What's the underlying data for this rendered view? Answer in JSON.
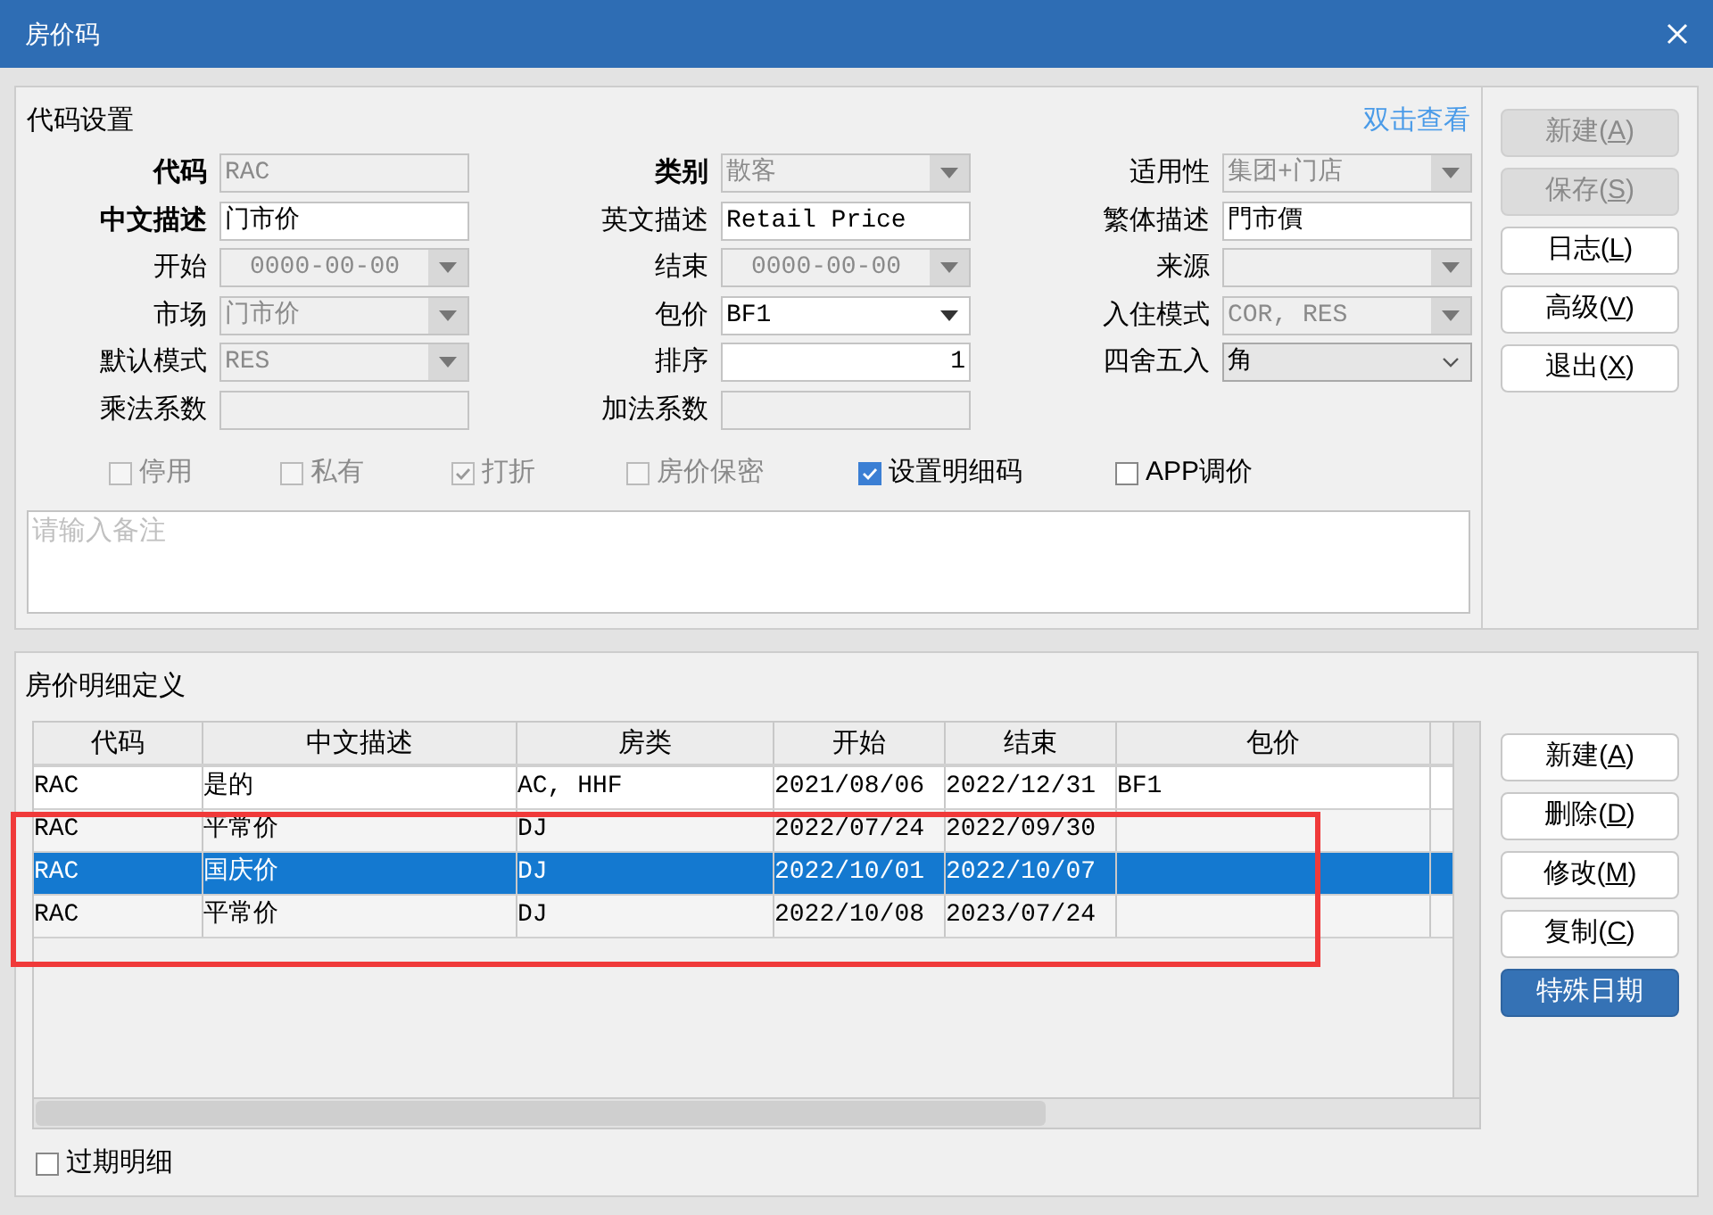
{
  "window": {
    "title": "房价码"
  },
  "code_settings": {
    "title": "代码设置",
    "link": "双击查看",
    "form_rows": [
      {
        "fields": [
          {
            "label": "代码",
            "bold": true,
            "kind": "text",
            "disabled": true,
            "value": "RAC"
          },
          {
            "label": "类别",
            "bold": true,
            "kind": "select",
            "disabled": true,
            "value": "散客"
          },
          {
            "label": "适用性",
            "bold": false,
            "kind": "select",
            "disabled": true,
            "value": "集团+门店"
          }
        ]
      },
      {
        "fields": [
          {
            "label": "中文描述",
            "bold": true,
            "kind": "text",
            "disabled": false,
            "value": "门市价"
          },
          {
            "label": "英文描述",
            "bold": false,
            "kind": "text",
            "disabled": false,
            "value": "Retail Price"
          },
          {
            "label": "繁体描述",
            "bold": false,
            "kind": "text",
            "disabled": false,
            "value": "門市價"
          }
        ]
      },
      {
        "fields": [
          {
            "label": "开始",
            "bold": false,
            "kind": "date",
            "disabled": true,
            "value": "0000-00-00"
          },
          {
            "label": "结束",
            "bold": false,
            "kind": "date",
            "disabled": true,
            "value": "0000-00-00"
          },
          {
            "label": "来源",
            "bold": false,
            "kind": "select",
            "disabled": true
          }
        ]
      },
      {
        "fields": [
          {
            "label": "市场",
            "bold": false,
            "kind": "select",
            "disabled": true,
            "value": "门市价"
          },
          {
            "label": "包价",
            "bold": false,
            "kind": "select",
            "disabled": false,
            "value": "BF1"
          },
          {
            "label": "入住模式",
            "bold": false,
            "kind": "select",
            "disabled": true,
            "value": "COR, RES"
          }
        ]
      },
      {
        "fields": [
          {
            "label": "默认模式",
            "bold": false,
            "kind": "select",
            "disabled": true,
            "value": "RES"
          },
          {
            "label": "排序",
            "bold": false,
            "kind": "number",
            "disabled": false,
            "value": "1"
          },
          {
            "label": "四舍五入",
            "bold": false,
            "kind": "combo",
            "disabled": false,
            "value": "角"
          }
        ]
      },
      {
        "fields": [
          {
            "label": "乘法系数",
            "bold": false,
            "kind": "text",
            "disabled": true
          },
          {
            "label": "加法系数",
            "bold": false,
            "kind": "text",
            "disabled": true
          }
        ]
      }
    ],
    "checkboxes": [
      {
        "label": "停用",
        "checked": false,
        "disabled": true
      },
      {
        "label": "私有",
        "checked": false,
        "disabled": true
      },
      {
        "label": "打折",
        "checked": true,
        "disabled": true
      },
      {
        "label": "房价保密",
        "checked": false,
        "disabled": true
      },
      {
        "label": "设置明细码",
        "checked": true,
        "disabled": false
      },
      {
        "label": "APP调价",
        "checked": false,
        "disabled": false
      }
    ],
    "remark": {
      "placeholder": "请输入备注"
    }
  },
  "top_buttons": [
    {
      "text": "新建(",
      "hotkey": "A",
      "tail": ")",
      "disabled": true
    },
    {
      "text": "保存(",
      "hotkey": "S",
      "tail": ")",
      "disabled": true
    },
    {
      "text": "日志(",
      "hotkey": "L",
      "tail": ")",
      "disabled": false
    },
    {
      "text": "高级(",
      "hotkey": "V",
      "tail": ")",
      "disabled": false
    },
    {
      "text": "退出(",
      "hotkey": "X",
      "tail": ")",
      "disabled": false
    }
  ],
  "details": {
    "title": "房价明细定义",
    "table": {
      "columns": [
        "代码",
        "中文描述",
        "房类",
        "开始",
        "结束",
        "包价"
      ],
      "rows": [
        {
          "cells": [
            "RAC",
            "是的",
            "AC, HHF",
            "2021/08/06",
            "2022/12/31",
            "BF1"
          ],
          "selected": false
        },
        {
          "cells": [
            "RAC",
            "平常价",
            "DJ",
            "2022/07/24",
            "2022/09/30",
            ""
          ],
          "selected": false
        },
        {
          "cells": [
            "RAC",
            "国庆价",
            "DJ",
            "2022/10/01",
            "2022/10/07",
            ""
          ],
          "selected": true
        },
        {
          "cells": [
            "RAC",
            "平常价",
            "DJ",
            "2022/10/08",
            "2023/07/24",
            ""
          ],
          "selected": false
        }
      ]
    },
    "expired_checkbox": {
      "label": "过期明细",
      "checked": false
    }
  },
  "detail_buttons": [
    {
      "kind": "normal",
      "text": "新建(",
      "hotkey": "A",
      "tail": ")"
    },
    {
      "kind": "normal",
      "text": "删除(",
      "hotkey": "D",
      "tail": ")"
    },
    {
      "kind": "normal",
      "text": "修改(",
      "hotkey": "M",
      "tail": ")"
    },
    {
      "kind": "normal",
      "text": "复制(",
      "hotkey": "C",
      "tail": ")"
    },
    {
      "kind": "primary",
      "text": "特殊日期"
    }
  ]
}
